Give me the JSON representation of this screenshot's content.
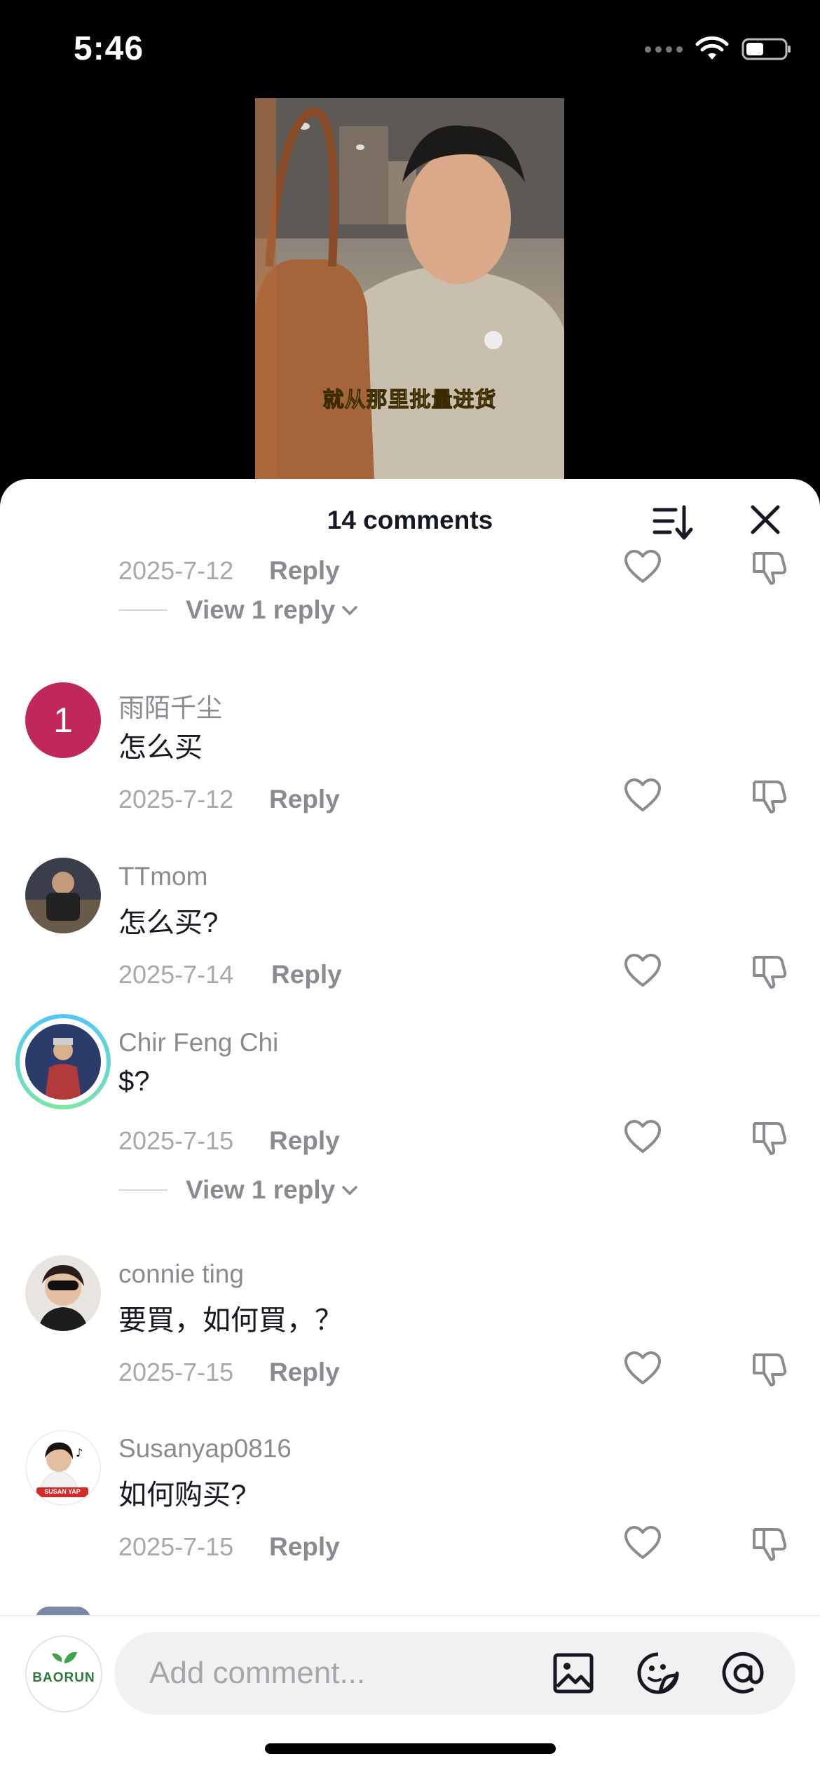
{
  "status_bar": {
    "time": "5:46"
  },
  "video": {
    "caption": "就从那里批量进货"
  },
  "sheet": {
    "title": "14 comments"
  },
  "comments": [
    {
      "date": "2025-7-12",
      "reply_label": "Reply",
      "view_replies": "View 1 reply"
    },
    {
      "username": "雨陌千尘",
      "avatar_letter": "1",
      "avatar_color": "#c0275a",
      "text": "怎么买",
      "date": "2025-7-12",
      "reply_label": "Reply"
    },
    {
      "username": "TTmom",
      "text": "怎么买?",
      "date": "2025-7-14",
      "reply_label": "Reply"
    },
    {
      "username": "Chir Feng Chi",
      "text": "$?",
      "date": "2025-7-15",
      "reply_label": "Reply",
      "view_replies": "View 1 reply"
    },
    {
      "username": "connie ting",
      "text": "要買，如何買，？",
      "date": "2025-7-15",
      "reply_label": "Reply"
    },
    {
      "username": "Susanyap0816",
      "avatar_badge": "SUSAN YAP",
      "text": "如何购买?",
      "date": "2025-7-15",
      "reply_label": "Reply"
    }
  ],
  "input_bar": {
    "placeholder": "Add comment...",
    "my_avatar_logo": "BAORUN",
    "icons": [
      "image-icon",
      "sticker-icon",
      "mention-icon"
    ]
  },
  "colors": {
    "text_primary": "#161823",
    "text_secondary": "#8a8b91",
    "sheet_bg": "#ffffff"
  }
}
